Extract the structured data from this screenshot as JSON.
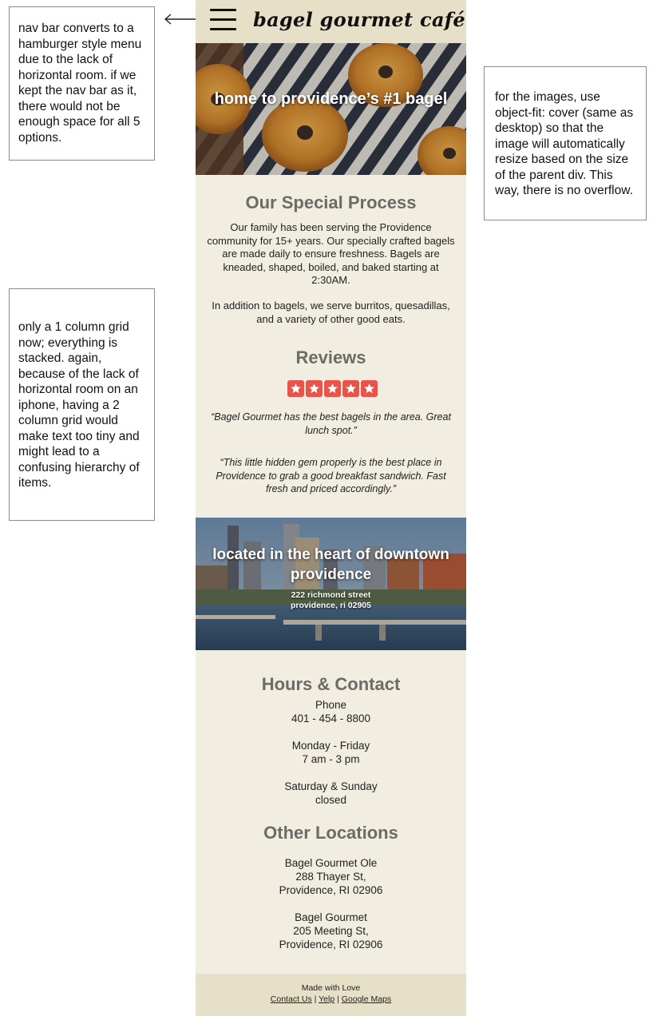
{
  "annotations": {
    "nav_note": "nav bar converts to a hamburger style menu due to the lack of horizontal room. if we kept the nav bar as it, there would not be enough space for all 5 options.",
    "grid_note": "only a 1 column grid now; everything is stacked. again, because of the lack of horizontal room on an iphone, having a 2 column grid would make text too tiny and might lead to a confusing hierarchy of items.",
    "image_note": "for the images, use object-fit: cover (same as desktop) so that the image will automatically resize based on the size of the parent div. This way, there is no overflow."
  },
  "nav": {
    "brand": "bagel gourmet café",
    "menu_icon": "hamburger-icon"
  },
  "hero": {
    "title": "home to providence’s #1 bagel"
  },
  "process": {
    "title": "Our Special Process",
    "p1": "Our family has been serving the Providence community for 15+ years. Our specially crafted bagels are made daily to ensure freshness. Bagels are kneaded, shaped, boiled, and baked starting at 2:30AM.",
    "p2": "In addition to bagels, we serve burritos, quesadillas, and a variety of other good eats."
  },
  "reviews": {
    "title": "Reviews",
    "rating": 5,
    "star_color": "#e8544a",
    "items": [
      "“Bagel Gourmet has the best bagels in the area. Great lunch spot.”",
      "“This little hidden gem properly is the best place in Providence to grab a good breakfast sandwich. Fast fresh and priced accordingly.”"
    ]
  },
  "location": {
    "title": "located in the heart of downtown providence",
    "street": "222 richmond street",
    "city": "providence, ri 02905"
  },
  "hours": {
    "title": "Hours & Contact",
    "phone_label": "Phone",
    "phone": "401 - 454 - 8800",
    "weekday_label": "Monday - Friday",
    "weekday_hours": "7 am - 3 pm",
    "weekend_label": "Saturday & Sunday",
    "weekend_hours": "closed"
  },
  "other_locations": {
    "title": "Other Locations",
    "locations": [
      {
        "name": "Bagel Gourmet Ole",
        "street": "288 Thayer St,",
        "city": "Providence, RI 02906"
      },
      {
        "name": "Bagel Gourmet",
        "street": "205 Meeting St,",
        "city": "Providence, RI 02906"
      }
    ]
  },
  "footer": {
    "made": "Made with Love",
    "links": [
      "Contact Us",
      "Yelp",
      "Google Maps"
    ],
    "separator": " | "
  },
  "colors": {
    "nav_bg": "#e6e0c8",
    "page_bg": "#f1ede0",
    "heading": "#6d6b66"
  }
}
